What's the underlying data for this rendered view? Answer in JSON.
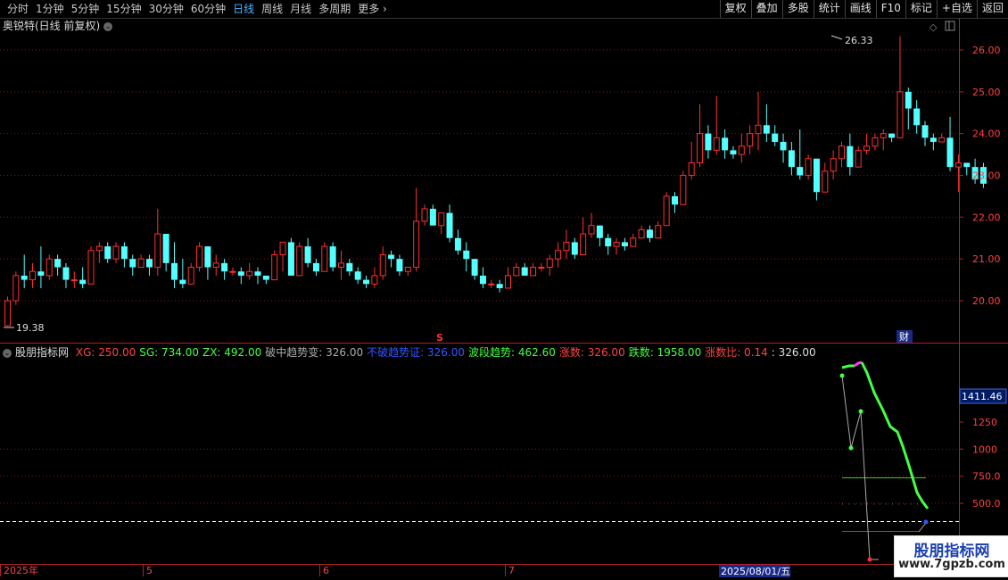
{
  "toolbar": {
    "periods": [
      "分时",
      "1分钟",
      "5分钟",
      "15分钟",
      "30分钟",
      "60分钟",
      "日线",
      "周线",
      "月线",
      "多周期",
      "更多 ›"
    ],
    "active_period": "日线",
    "right_buttons": [
      "复权",
      "叠加",
      "多股",
      "统计",
      "画线",
      "F10",
      "标记",
      "+自选",
      "返回"
    ]
  },
  "main_chart": {
    "title": "奥锐特(日线 前复权)",
    "y_ticks": [
      "26.00",
      "25.00",
      "24.00",
      "23.00",
      "22.00",
      "21.00",
      "20.00"
    ],
    "high_label": "26.33",
    "low_label": "19.38",
    "marker_s": "S",
    "marker_cai": "财"
  },
  "indicator": {
    "name": "股朋指标网",
    "items": [
      {
        "text": "XG: 250.00",
        "color": "#ff4444"
      },
      {
        "text": "SG: 734.00",
        "color": "#44ff44"
      },
      {
        "text": "ZX: 492.00",
        "color": "#44ff44"
      },
      {
        "text": "破中趋势变: 326.00",
        "color": "#aaaaaa"
      },
      {
        "text": "不破趋势证: 326.00",
        "color": "#3355ff"
      },
      {
        "text": "波段趋势: 462.60",
        "color": "#44ff44"
      },
      {
        "text": "涨数: 326.00",
        "color": "#ff4444"
      },
      {
        "text": "跌数: 1958.00",
        "color": "#44ff44"
      },
      {
        "text": "涨数比: 0.14",
        "color": "#ff4444"
      },
      {
        "text": ": 326.00",
        "color": "#dddddd"
      }
    ],
    "y_ticks": [
      "1250",
      "1000",
      "750.0",
      "500.0"
    ],
    "current_value": "1411.46"
  },
  "date_axis": {
    "labels": [
      "2025年",
      "5",
      "6",
      "7"
    ],
    "cursor_date": "2025/08/01/五"
  },
  "watermark": {
    "line1": "股朋指标网",
    "line2": "www.7gpzb.com"
  },
  "chart_data": {
    "type": "candlestick",
    "title": "奥锐特(日线 前复权)",
    "ylim": [
      19.0,
      26.6
    ],
    "up_color": "#ff3030",
    "down_color": "#54ffff",
    "candles": [
      [
        19.4,
        20.0,
        19.38,
        20.1
      ],
      [
        20.0,
        20.6,
        19.9,
        20.7
      ],
      [
        20.6,
        20.5,
        20.3,
        21.1
      ],
      [
        20.5,
        20.7,
        20.3,
        20.9
      ],
      [
        20.7,
        20.6,
        20.3,
        21.3
      ],
      [
        20.6,
        21.0,
        20.5,
        21.1
      ],
      [
        21.0,
        20.8,
        20.6,
        21.1
      ],
      [
        20.8,
        20.5,
        20.3,
        20.9
      ],
      [
        20.5,
        20.5,
        20.3,
        20.7
      ],
      [
        20.5,
        20.4,
        20.3,
        20.8
      ],
      [
        20.4,
        21.2,
        20.4,
        21.3
      ],
      [
        21.2,
        21.3,
        20.9,
        21.4
      ],
      [
        21.3,
        21.0,
        20.9,
        21.4
      ],
      [
        21.0,
        21.3,
        20.9,
        21.4
      ],
      [
        21.3,
        21.0,
        20.8,
        21.4
      ],
      [
        21.0,
        20.8,
        20.6,
        21.1
      ],
      [
        20.8,
        21.0,
        20.8,
        21.1
      ],
      [
        21.0,
        20.8,
        20.6,
        21.1
      ],
      [
        20.8,
        21.6,
        20.6,
        22.2
      ],
      [
        21.6,
        20.9,
        20.7,
        21.6
      ],
      [
        20.9,
        20.5,
        20.3,
        21.4
      ],
      [
        20.5,
        20.4,
        20.3,
        21.0
      ],
      [
        20.4,
        20.8,
        20.4,
        20.9
      ],
      [
        20.8,
        21.3,
        20.7,
        21.4
      ],
      [
        21.3,
        20.8,
        20.5,
        21.3
      ],
      [
        20.8,
        20.9,
        20.6,
        21.1
      ],
      [
        20.9,
        20.7,
        20.5,
        21.0
      ],
      [
        20.7,
        20.7,
        20.6,
        20.8
      ],
      [
        20.7,
        20.6,
        20.4,
        20.8
      ],
      [
        20.6,
        20.7,
        20.5,
        20.9
      ],
      [
        20.7,
        20.6,
        20.4,
        20.8
      ],
      [
        20.6,
        20.5,
        20.4,
        20.6
      ],
      [
        20.5,
        21.1,
        20.6,
        21.2
      ],
      [
        21.1,
        21.4,
        20.7,
        21.4
      ],
      [
        21.4,
        20.6,
        20.6,
        21.5
      ],
      [
        20.6,
        21.3,
        20.6,
        21.4
      ],
      [
        21.3,
        20.9,
        20.8,
        21.5
      ],
      [
        20.9,
        20.7,
        20.6,
        21.0
      ],
      [
        20.7,
        21.3,
        20.7,
        21.4
      ],
      [
        21.3,
        20.8,
        20.7,
        21.4
      ],
      [
        20.8,
        20.9,
        20.5,
        21.2
      ],
      [
        20.9,
        20.7,
        20.6,
        21.0
      ],
      [
        20.7,
        20.5,
        20.4,
        20.8
      ],
      [
        20.5,
        20.4,
        20.3,
        20.6
      ],
      [
        20.4,
        20.6,
        20.3,
        20.8
      ],
      [
        20.6,
        21.1,
        20.5,
        21.3
      ],
      [
        21.1,
        21.0,
        20.8,
        21.2
      ],
      [
        21.0,
        20.7,
        20.6,
        21.1
      ],
      [
        20.7,
        20.8,
        20.6,
        20.8
      ],
      [
        20.8,
        21.9,
        20.7,
        22.7
      ],
      [
        21.9,
        22.2,
        21.8,
        22.3
      ],
      [
        22.2,
        21.8,
        21.8,
        22.3
      ],
      [
        21.8,
        22.1,
        21.6,
        22.1
      ],
      [
        22.1,
        21.5,
        21.4,
        22.3
      ],
      [
        21.5,
        21.2,
        21.1,
        21.7
      ],
      [
        21.2,
        21.0,
        20.7,
        21.4
      ],
      [
        21.0,
        20.6,
        20.5,
        21.0
      ],
      [
        20.6,
        20.4,
        20.3,
        20.8
      ],
      [
        20.4,
        20.4,
        20.3,
        20.5
      ],
      [
        20.4,
        20.3,
        20.2,
        20.5
      ],
      [
        20.3,
        20.6,
        20.4,
        20.8
      ],
      [
        20.6,
        20.8,
        20.6,
        20.9
      ],
      [
        20.8,
        20.6,
        20.6,
        20.9
      ],
      [
        20.6,
        20.8,
        20.6,
        20.9
      ],
      [
        20.8,
        20.8,
        20.7,
        20.9
      ],
      [
        20.8,
        21.0,
        20.6,
        21.1
      ],
      [
        21.0,
        21.2,
        20.8,
        21.4
      ],
      [
        21.2,
        21.4,
        21.0,
        21.7
      ],
      [
        21.4,
        21.1,
        21.0,
        21.5
      ],
      [
        21.1,
        21.6,
        21.1,
        22.0
      ],
      [
        21.6,
        21.8,
        21.5,
        22.1
      ],
      [
        21.8,
        21.5,
        21.3,
        21.8
      ],
      [
        21.5,
        21.3,
        21.1,
        21.6
      ],
      [
        21.3,
        21.4,
        21.1,
        21.5
      ],
      [
        21.4,
        21.3,
        21.2,
        21.5
      ],
      [
        21.3,
        21.5,
        21.4,
        21.6
      ],
      [
        21.5,
        21.7,
        21.5,
        21.8
      ],
      [
        21.7,
        21.5,
        21.4,
        21.8
      ],
      [
        21.5,
        21.8,
        21.6,
        21.9
      ],
      [
        21.8,
        22.5,
        21.8,
        22.6
      ],
      [
        22.5,
        22.3,
        22.1,
        22.6
      ],
      [
        22.3,
        23.0,
        22.3,
        23.1
      ],
      [
        23.0,
        23.3,
        22.9,
        23.8
      ],
      [
        23.3,
        24.0,
        23.2,
        24.7
      ],
      [
        24.0,
        23.6,
        23.4,
        24.2
      ],
      [
        23.6,
        23.9,
        23.5,
        24.9
      ],
      [
        23.9,
        23.6,
        23.4,
        24.1
      ],
      [
        23.6,
        23.5,
        23.4,
        23.7
      ],
      [
        23.5,
        23.7,
        23.3,
        24.0
      ],
      [
        23.7,
        24.0,
        23.5,
        24.2
      ],
      [
        24.0,
        24.2,
        23.6,
        25.0
      ],
      [
        24.2,
        24.0,
        23.8,
        24.7
      ],
      [
        24.0,
        23.8,
        23.7,
        24.2
      ],
      [
        23.8,
        23.6,
        23.3,
        24.0
      ],
      [
        23.6,
        23.2,
        23.0,
        23.8
      ],
      [
        23.2,
        23.0,
        22.9,
        24.1
      ],
      [
        23.0,
        23.4,
        22.9,
        23.5
      ],
      [
        23.4,
        22.6,
        22.4,
        23.0
      ],
      [
        22.6,
        23.1,
        22.9,
        23.3
      ],
      [
        23.1,
        23.4,
        22.9,
        23.6
      ],
      [
        23.4,
        23.7,
        23.2,
        23.8
      ],
      [
        23.7,
        23.2,
        23.0,
        24.0
      ],
      [
        23.2,
        23.6,
        23.3,
        23.7
      ],
      [
        23.6,
        23.7,
        23.5,
        24.0
      ],
      [
        23.7,
        23.9,
        23.6,
        24.0
      ],
      [
        23.9,
        24.0,
        23.6,
        24.1
      ],
      [
        24.0,
        23.9,
        23.8,
        24.0
      ],
      [
        23.9,
        25.0,
        23.9,
        26.33
      ],
      [
        25.0,
        24.6,
        24.1,
        25.1
      ],
      [
        24.6,
        24.2,
        24.0,
        24.8
      ],
      [
        24.2,
        23.9,
        23.7,
        24.3
      ],
      [
        23.9,
        23.8,
        23.6,
        24.0
      ],
      [
        23.8,
        23.9,
        23.8,
        24.0
      ],
      [
        23.9,
        23.2,
        23.1,
        24.4
      ],
      [
        23.2,
        23.3,
        22.6,
        23.5
      ],
      [
        23.3,
        23.2,
        23.0,
        23.3
      ],
      [
        23.2,
        22.9,
        22.8,
        23.4
      ],
      [
        23.2,
        22.8,
        22.7,
        23.3
      ]
    ]
  }
}
